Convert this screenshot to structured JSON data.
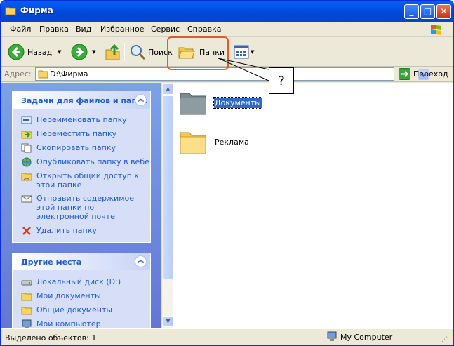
{
  "window": {
    "title": "Фирма"
  },
  "menu": [
    "Файл",
    "Правка",
    "Вид",
    "Избранное",
    "Сервис",
    "Справка"
  ],
  "toolbar": {
    "back": "Назад",
    "search": "Поиск",
    "folders": "Папки"
  },
  "address": {
    "label": "Адрес:",
    "value": "D:\\Фирма",
    "go": "Переход"
  },
  "tasks_panel": {
    "title": "Задачи для файлов и папок",
    "items": [
      {
        "label": "Переименовать папку",
        "icon": "rename-icon"
      },
      {
        "label": "Переместить папку",
        "icon": "move-icon"
      },
      {
        "label": "Скопировать папку",
        "icon": "copy-icon"
      },
      {
        "label": "Опубликовать папку в вебе",
        "icon": "web-publish-icon"
      },
      {
        "label": "Открыть общий доступ к этой папке",
        "icon": "share-icon"
      },
      {
        "label": "Отправить содержимое этой папки по электронной почте",
        "icon": "email-icon"
      },
      {
        "label": "Удалить папку",
        "icon": "delete-icon"
      }
    ]
  },
  "places_panel": {
    "title": "Другие места",
    "items": [
      {
        "label": "Локальный диск (D:)",
        "icon": "disk-icon"
      },
      {
        "label": "Мои документы",
        "icon": "folder-icon"
      },
      {
        "label": "Общие документы",
        "icon": "folder-icon"
      },
      {
        "label": "Мой компьютер",
        "icon": "computer-icon"
      }
    ]
  },
  "folders": [
    {
      "name": "Документы",
      "selected": true
    },
    {
      "name": "Реклама",
      "selected": false
    }
  ],
  "status": {
    "left": "Выделено объектов: 1",
    "right": "My Computer"
  },
  "callout": {
    "text": "?"
  }
}
